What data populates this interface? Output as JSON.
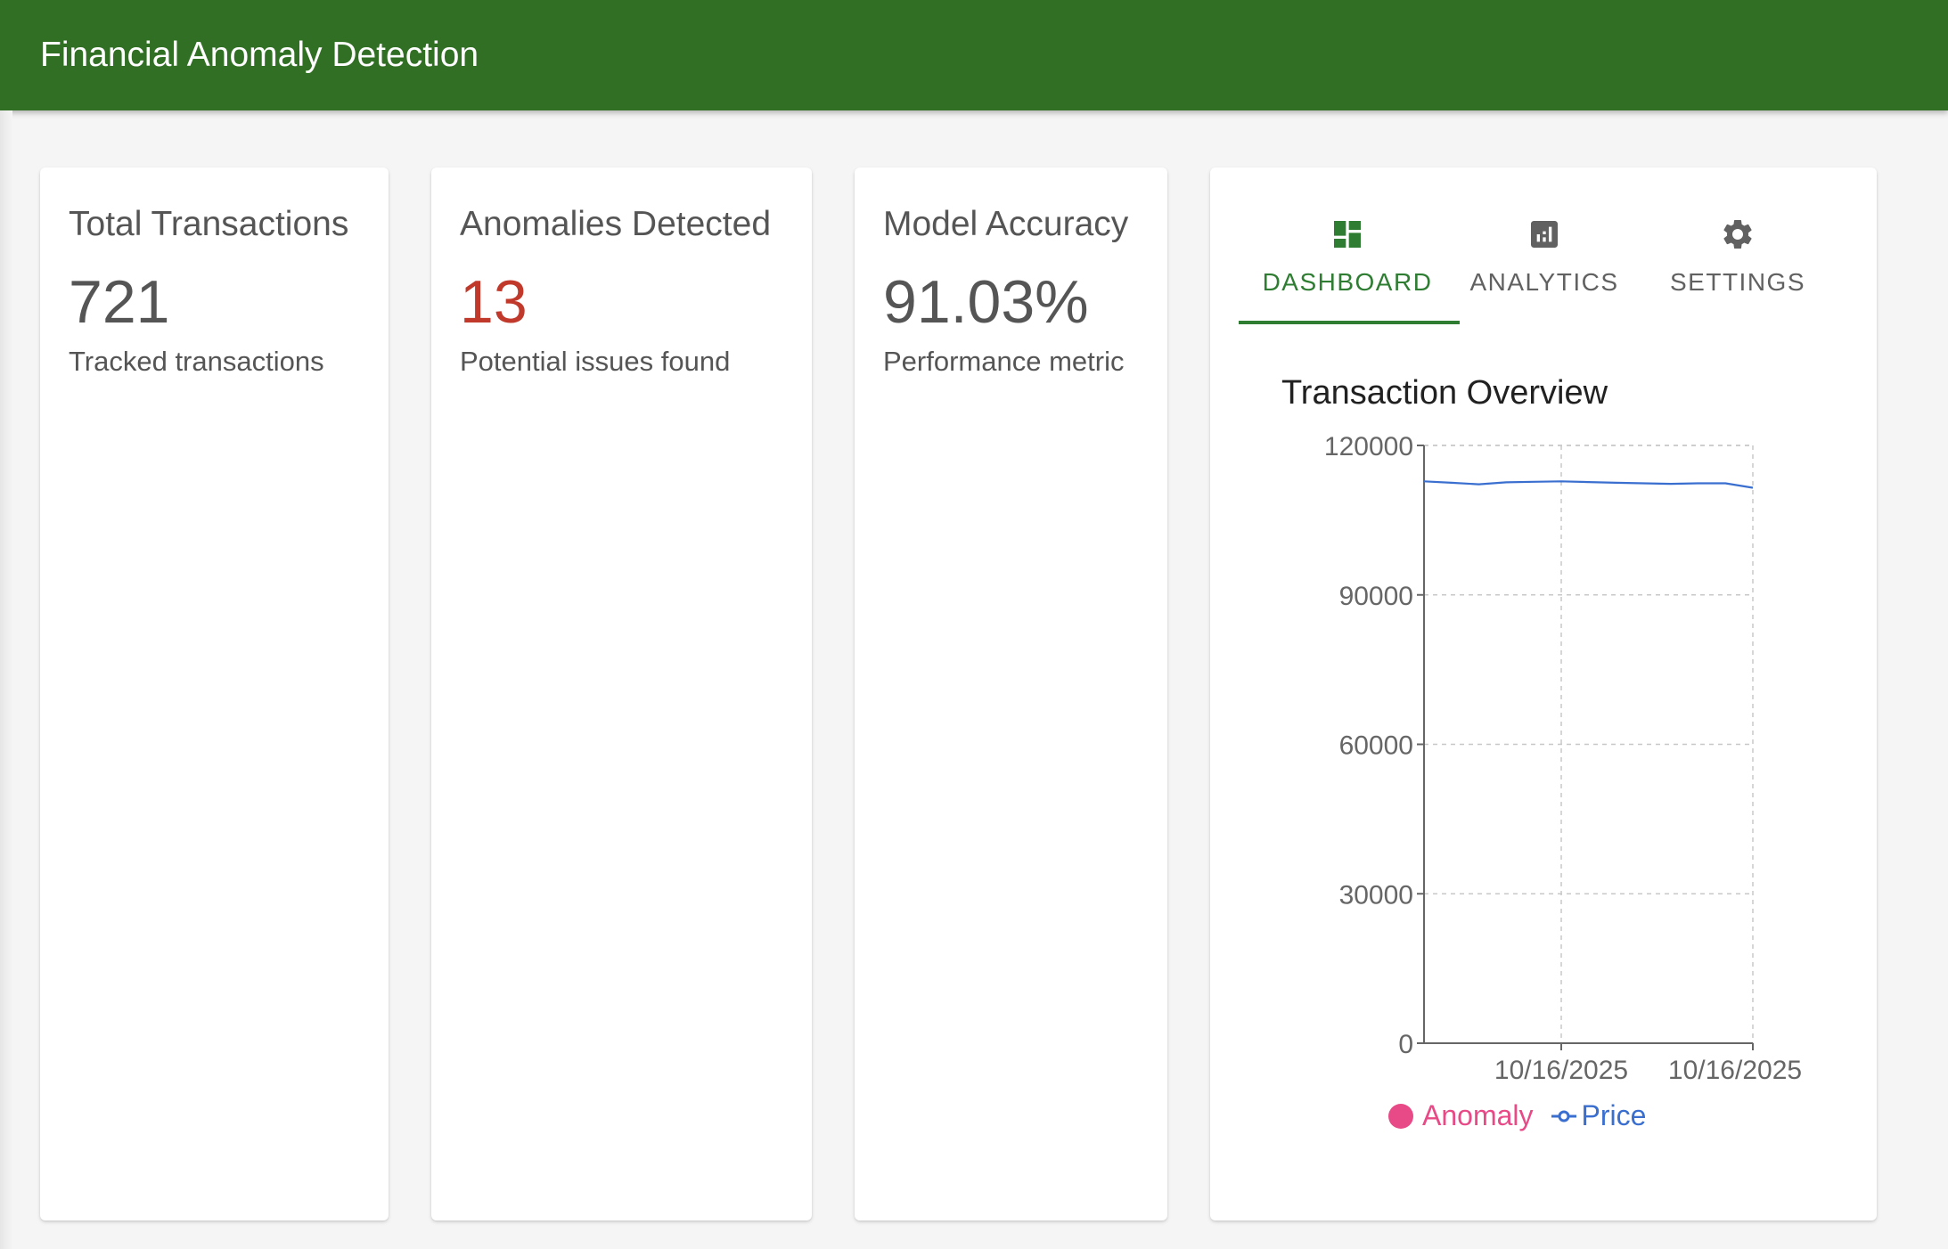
{
  "app": {
    "title": "Financial Anomaly Detection"
  },
  "stats": [
    {
      "title": "Total Transactions",
      "value": "721",
      "subtitle": "Tracked transactions"
    },
    {
      "title": "Anomalies Detected",
      "value": "13",
      "subtitle": "Potential issues found",
      "value_color": "#c0392b"
    },
    {
      "title": "Model Accuracy",
      "value": "91.03%",
      "subtitle": "Performance metric"
    }
  ],
  "tabs": [
    {
      "label": "DASHBOARD",
      "icon": "dashboard-icon",
      "active": true
    },
    {
      "label": "ANALYTICS",
      "icon": "analytics-icon",
      "active": false
    },
    {
      "label": "SETTINGS",
      "icon": "gear-icon",
      "active": false
    }
  ],
  "colors": {
    "app_bar": "#317024",
    "accent": "#2e7d32",
    "anomaly": "#e84a87",
    "price": "#3a6fd0",
    "danger": "#c0392b"
  },
  "chart_data": {
    "type": "line",
    "title": "Transaction Overview",
    "y_ticks": [
      "0",
      "30000",
      "60000",
      "90000",
      "120000"
    ],
    "ylim": [
      0,
      120000
    ],
    "x_tick_labels": [
      "10/16/2025",
      "10/16/2025"
    ],
    "grid": true,
    "legend_position": "bottom",
    "series": [
      {
        "name": "Price",
        "color": "#3a6fd0",
        "values": [
          112800,
          112500,
          112200,
          112600,
          112700,
          112800,
          112650,
          112500,
          112400,
          112300,
          112400,
          112400,
          111500
        ]
      }
    ],
    "legend": [
      "Anomaly",
      "Price"
    ]
  }
}
